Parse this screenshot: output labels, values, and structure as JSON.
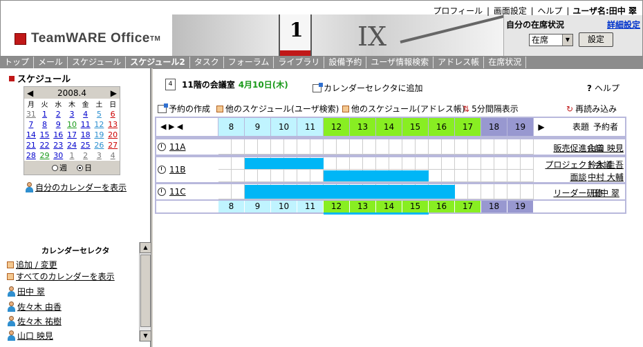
{
  "toplinks": [
    "プロフィール",
    "画面設定",
    "ヘルプ"
  ],
  "user_label": "ユーザ名:田中 翠",
  "logo": {
    "text": "TeamWARE Office",
    "tm": "TM"
  },
  "banner": {
    "clock_digit": "1",
    "roman": "IX"
  },
  "presence": {
    "title": "自分の在席状況",
    "detail": "詳細設定",
    "value": "在席",
    "button": "設定"
  },
  "menu": [
    "トップ",
    "メール",
    "スケジュール",
    "スケジュール2",
    "タスク",
    "フォーラム",
    "ライブラリ",
    "設備予約",
    "ユーザ情報検索",
    "アドレス帳",
    "在席状況"
  ],
  "sidebar": {
    "title": "スケジュール",
    "calendar": {
      "month": "2008.4",
      "weekdays": [
        "月",
        "火",
        "水",
        "木",
        "金",
        "土",
        "日"
      ],
      "weeks": [
        [
          "31",
          "1",
          "2",
          "3",
          "4",
          "5",
          "6"
        ],
        [
          "7",
          "8",
          "9",
          "10",
          "11",
          "12",
          "13"
        ],
        [
          "14",
          "15",
          "16",
          "17",
          "18",
          "19",
          "20"
        ],
        [
          "21",
          "22",
          "23",
          "24",
          "25",
          "26",
          "27"
        ],
        [
          "28",
          "29",
          "30",
          "1",
          "2",
          "3",
          "4"
        ]
      ],
      "view_week": "週",
      "view_day": "日"
    },
    "my_calendar": "自分のカレンダーを表示",
    "selector": {
      "title": "カレンダーセレクタ",
      "add": "追加 / 変更",
      "show_all": "すべてのカレンダーを表示",
      "users": [
        "田中 翠",
        "佐々木 由香",
        "佐々木 祐樹",
        "山口 映見"
      ]
    }
  },
  "main": {
    "page_no": "4",
    "room": "11階の会議室",
    "date": "4月10日(木)",
    "add_selector": "カレンダーセレクタに追加",
    "help": "ヘルプ",
    "create": "予約の作成",
    "other_user": "他のスケジュール(ユーザ検索)",
    "other_addr": "他のスケジュール(アドレス帳)",
    "interval": "5分間隔表示",
    "reload": "再読み込み",
    "hours": [
      "8",
      "9",
      "10",
      "11",
      "12",
      "13",
      "14",
      "15",
      "16",
      "17",
      "18",
      "19"
    ],
    "col_title": "表題",
    "col_booker": "予約者",
    "rooms": [
      {
        "name": "11A",
        "events": [
          {
            "title": "販売促進会議",
            "booker": "山口 映見"
          }
        ]
      },
      {
        "name": "11B",
        "events": [
          {
            "title": "プロジェクト会議",
            "booker": "鈴木 圭吾"
          },
          {
            "title": "面談",
            "booker": "中村 大輔"
          }
        ]
      },
      {
        "name": "11C",
        "events": [
          {
            "title": "リーダー研修",
            "booker": "田中 翠"
          }
        ]
      }
    ]
  },
  "colors": {
    "morning": "#c0f4ff",
    "core": "#88ee22",
    "evening": "#9898d0",
    "booking": "#00b6f6"
  }
}
